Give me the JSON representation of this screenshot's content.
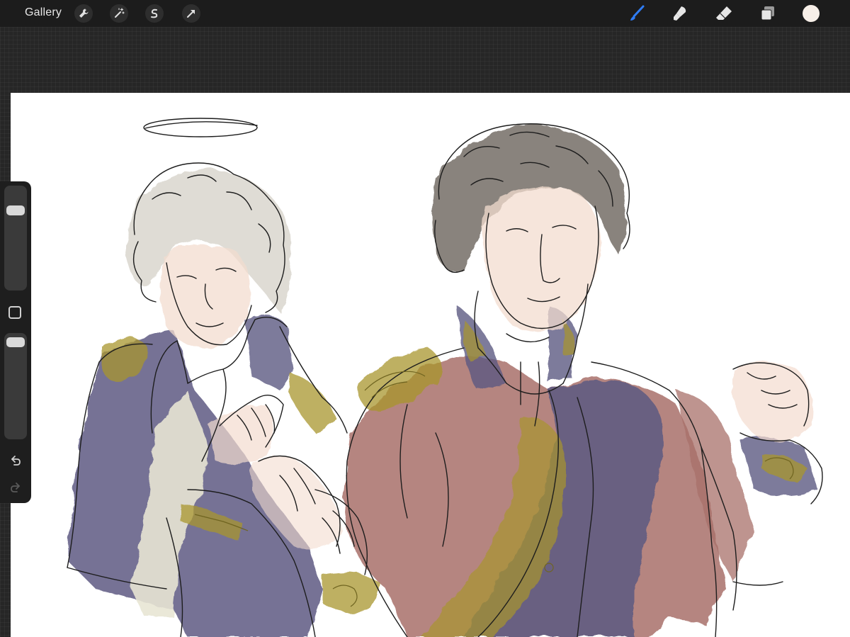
{
  "toolbar": {
    "gallery_label": "Gallery",
    "left_tools": [
      {
        "icon": "wrench-icon"
      },
      {
        "icon": "magic-wand-icon"
      },
      {
        "icon": "selection-icon"
      },
      {
        "icon": "transform-arrow-icon"
      }
    ],
    "right_tools": [
      {
        "icon": "brush-icon",
        "active": true,
        "color": "#2f7df6"
      },
      {
        "icon": "smudge-icon"
      },
      {
        "icon": "eraser-icon"
      },
      {
        "icon": "layers-icon"
      }
    ],
    "current_color": "#f7efe8"
  },
  "sidebar": {
    "brush_size_level": 0.97,
    "opacity_level": 1.0,
    "icons": [
      "modify-square-icon",
      "undo-icon",
      "redo-icon"
    ]
  },
  "canvas": {
    "background": "#ffffff",
    "palette": {
      "navy": "#5d5a82",
      "red_coat": "#a8706a",
      "gold": "#a8962e",
      "skin": "#f3dccf",
      "hair_grey": "#d9d6ce",
      "hair_dark": "#6b645c",
      "cream": "#e8e6d4"
    }
  }
}
